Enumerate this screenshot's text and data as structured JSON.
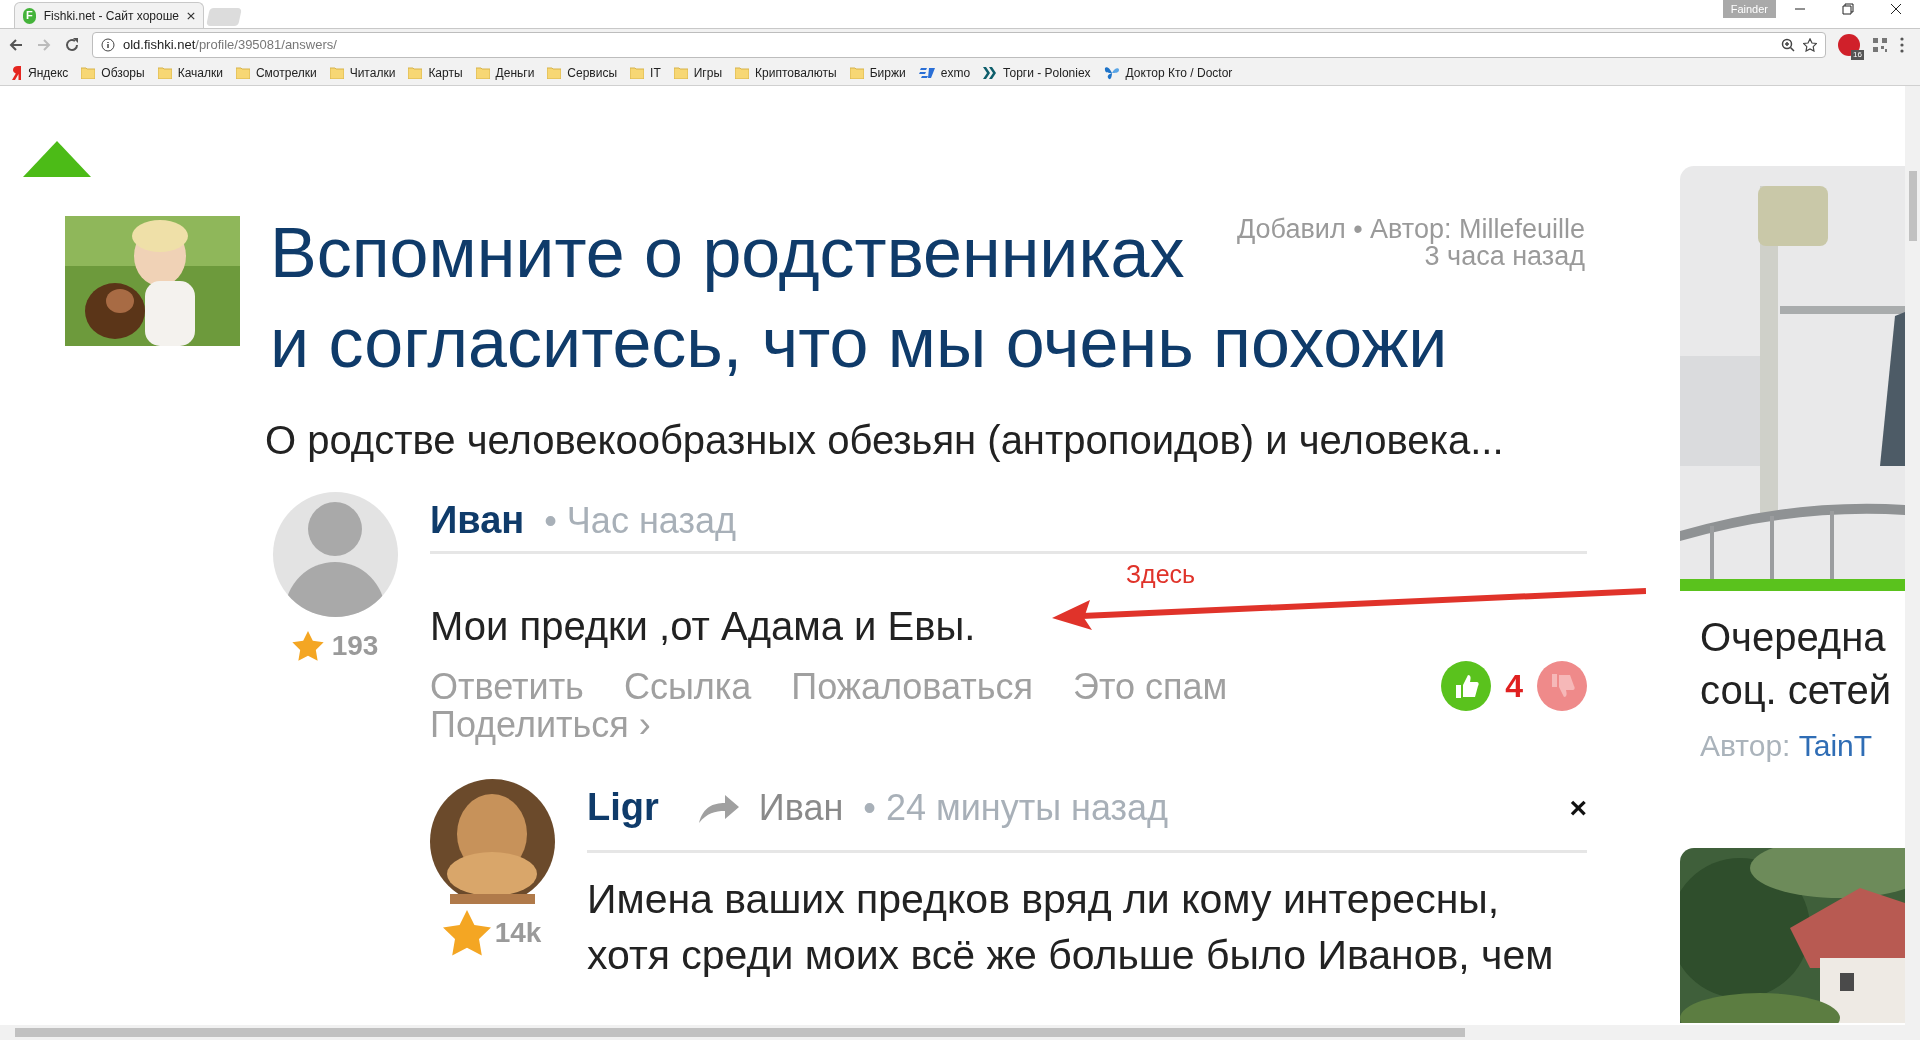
{
  "browser": {
    "tab": {
      "icon_letter": "F",
      "title": "Fishki.net - Сайт хороше"
    },
    "profile": "Fainder",
    "url": {
      "host": "old.fishki.net",
      "path": "/profile/395081/answers/"
    },
    "adblock_count": "16",
    "bookmarks": [
      {
        "kind": "yandex",
        "label": "Яндекс"
      },
      {
        "kind": "folder",
        "label": "Обзоры"
      },
      {
        "kind": "folder",
        "label": "Качалки"
      },
      {
        "kind": "folder",
        "label": "Смотрелки"
      },
      {
        "kind": "folder",
        "label": "Читалки"
      },
      {
        "kind": "folder",
        "label": "Карты"
      },
      {
        "kind": "folder",
        "label": "Деньги"
      },
      {
        "kind": "folder",
        "label": "Сервисы"
      },
      {
        "kind": "folder",
        "label": "IT"
      },
      {
        "kind": "folder",
        "label": "Игры"
      },
      {
        "kind": "folder",
        "label": "Криптовалюты"
      },
      {
        "kind": "folder",
        "label": "Биржи"
      },
      {
        "kind": "exmo",
        "label": "exmo"
      },
      {
        "kind": "poloniex",
        "label": "Торги - Poloniex"
      },
      {
        "kind": "butterfly",
        "label": "Доктор Кто / Doctor"
      }
    ]
  },
  "post": {
    "title_lines": [
      "Вспомните о родственниках",
      "и согласитесь, что мы очень похожи"
    ],
    "byline": "Добавил • Автор: Millefeuille",
    "time": "3 часа назад",
    "subtitle": "О родстве человекообразных обезьян (антропоидов) и человека..."
  },
  "comment": {
    "author": "Иван",
    "time": "• Час назад",
    "rating": "193",
    "text": "Мои предки ,от Адама и Евы.",
    "actions": [
      "Ответить",
      "Ссылка",
      "Пожаловаться",
      "Это спам",
      "Поделиться ›"
    ],
    "votes": "4"
  },
  "annotation": {
    "label": "Здесь"
  },
  "reply": {
    "author": "Ligr",
    "to": "Иван",
    "time": "• 24 минуты назад",
    "rating": "14k",
    "close": "×",
    "text": "Имена ваших предков вряд ли кому интересны, хотя среди моих всё же больше было Иванов, чем"
  },
  "sidebar": {
    "title_lines": [
      "Очередна",
      "соц. сетей"
    ],
    "author_label": "Автор:",
    "author": "TainT"
  }
}
